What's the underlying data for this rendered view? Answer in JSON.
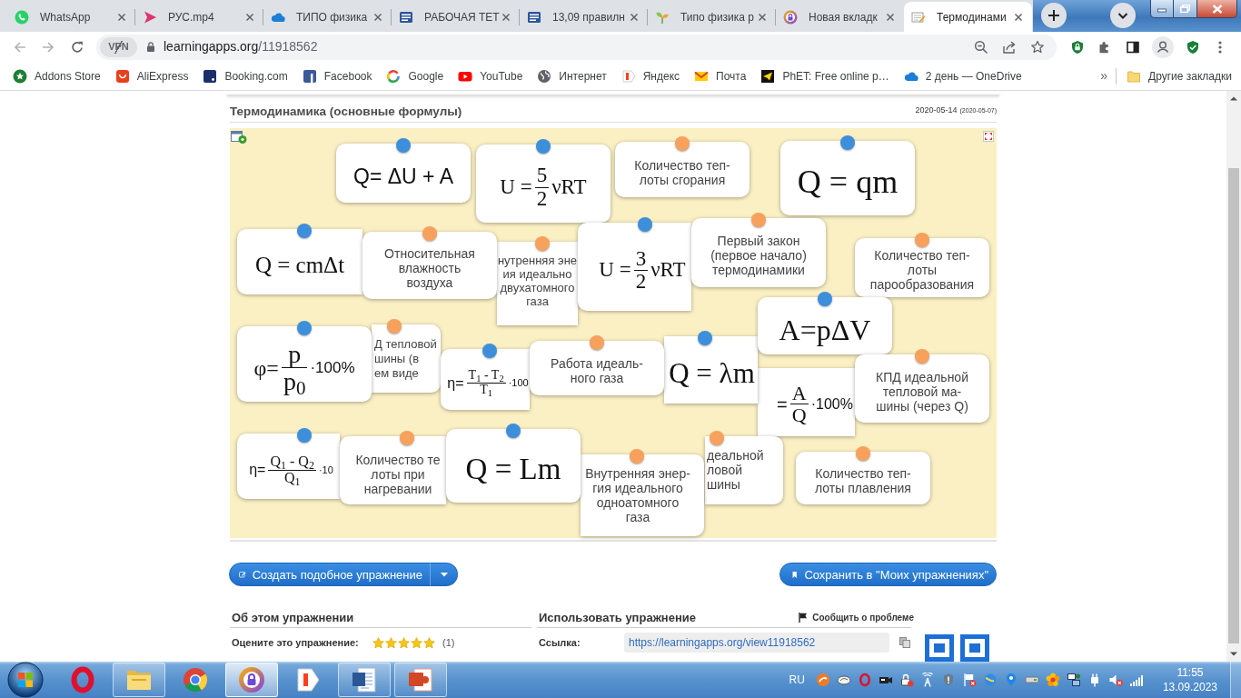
{
  "browser": {
    "tabs": [
      {
        "title": "WhatsApp",
        "selected": false
      },
      {
        "title": "РУС.mp4",
        "selected": false
      },
      {
        "title": "ТИПО физика",
        "selected": false
      },
      {
        "title": "РАБОЧАЯ ТЕТ",
        "selected": false
      },
      {
        "title": "13,09 правилн",
        "selected": false
      },
      {
        "title": "Типо физика р",
        "selected": false
      },
      {
        "title": "Новая вкладк",
        "selected": false
      },
      {
        "title": "Термодинами",
        "selected": true
      }
    ],
    "address": {
      "vpn": "VPN",
      "host": "learningapps.org",
      "path": "/11918562"
    },
    "bookmarks": [
      {
        "label": "Addons Store"
      },
      {
        "label": "AliExpress"
      },
      {
        "label": "Booking.com"
      },
      {
        "label": "Facebook"
      },
      {
        "label": "Google"
      },
      {
        "label": "YouTube"
      },
      {
        "label": "Интернет"
      },
      {
        "label": "Яндекс"
      },
      {
        "label": "Почта"
      },
      {
        "label": "PhET: Free online p…"
      },
      {
        "label": "2 день — OneDrive"
      }
    ],
    "bookmarks_overflow": "»",
    "other_bookmarks": "Другие закладки"
  },
  "exercise": {
    "title": "Термодинамика (основные формулы)",
    "updated": "2020-05-14",
    "created": "(2020-05-07)",
    "cards": [
      {
        "kind": "formula",
        "color": "#3d8fdb",
        "parts": [
          {
            "kind": "sans",
            "text": "Q= ΔU + A"
          }
        ]
      },
      {
        "kind": "formula",
        "color": "#3d8fdb",
        "parts": [
          {
            "kind": "serif",
            "text": "U ="
          },
          {
            "kind": "fraction",
            "numerator": "5",
            "denominator": "2"
          },
          {
            "kind": "serif",
            "text": "νRT"
          }
        ]
      },
      {
        "kind": "text",
        "color": "#f8a15c",
        "text": "Количество теп-\nлоты сгорания"
      },
      {
        "kind": "formula",
        "color": "#3d8fdb",
        "parts": [
          {
            "kind": "serif",
            "text": "Q = qm"
          }
        ]
      },
      {
        "kind": "formula",
        "color": "#3d8fdb",
        "parts": [
          {
            "kind": "serif",
            "text": "Q = cmΔt"
          }
        ]
      },
      {
        "kind": "text",
        "color": "#f8a15c",
        "text": "Относительная\nвлажность\nвоздуха"
      },
      {
        "kind": "text",
        "color": "#f8a15c",
        "text": "нутренняя эне\nия идеально\nдвухатомного\nгаза"
      },
      {
        "kind": "formula",
        "color": "#3d8fdb",
        "parts": [
          {
            "kind": "serif",
            "text": "U ="
          },
          {
            "kind": "fraction",
            "numerator": "3",
            "denominator": "2"
          },
          {
            "kind": "serif",
            "text": "νRT"
          }
        ]
      },
      {
        "kind": "text",
        "color": "#f8a15c",
        "text": "Первый закон\n(первое начало)\nтермодинамики"
      },
      {
        "kind": "text",
        "color": "#f8a15c",
        "text": "Количество теп-\nлоты\nпарообразования"
      },
      {
        "kind": "formula",
        "color": "#3d8fdb",
        "parts": [
          {
            "kind": "serif",
            "text": "A=pΔV"
          }
        ]
      },
      {
        "kind": "formula",
        "color": "#3d8fdb",
        "parts": [
          {
            "kind": "serif",
            "text": "φ="
          },
          {
            "kind": "fraction",
            "numerator": "p",
            "denominator": "p$_{0}$"
          },
          {
            "kind": "sans",
            "text": "·100%"
          }
        ]
      },
      {
        "kind": "text",
        "color": "#f8a15c",
        "text": "Д тепловой\nшины (в\nем виде"
      },
      {
        "kind": "formula",
        "color": "#3d8fdb",
        "parts": [
          {
            "kind": "sans",
            "text": "η="
          },
          {
            "kind": "fraction",
            "numerator": "T$_{1}$ - T$_{2}$",
            "denominator": "T$_{1}$"
          },
          {
            "kind": "sans",
            "text": "·100"
          }
        ]
      },
      {
        "kind": "text",
        "color": "#f8a15c",
        "text": "Работа идеаль-\nного газа"
      },
      {
        "kind": "formula",
        "color": "#3d8fdb",
        "parts": [
          {
            "kind": "serif",
            "text": "Q = λm"
          }
        ]
      },
      {
        "kind": "formula",
        "parts": [
          {
            "kind": "sans",
            "text": "="
          },
          {
            "kind": "fraction",
            "numerator": "A",
            "denominator": "Q"
          },
          {
            "kind": "sans",
            "text": "·100%"
          }
        ]
      },
      {
        "kind": "text",
        "color": "#f8a15c",
        "text": "КПД идеальной\nтепловой ма-\nшины (через Q)"
      },
      {
        "kind": "formula",
        "color": "#3d8fdb",
        "parts": [
          {
            "kind": "sans",
            "text": "η="
          },
          {
            "kind": "fraction",
            "numerator": "Q$_{1}$ - Q$_{2}$",
            "denominator": "Q$_{1}$"
          },
          {
            "kind": "sans",
            "text": "·10"
          }
        ]
      },
      {
        "kind": "text",
        "color": "#f8a15c",
        "text": "Количество те\nлоты при\nнагревании"
      },
      {
        "kind": "formula",
        "color": "#3d8fdb",
        "parts": [
          {
            "kind": "serif",
            "text": "Q = Lm"
          }
        ]
      },
      {
        "kind": "text",
        "color": "#f8a15c",
        "text": "деальной\nловой\nшины"
      },
      {
        "kind": "text",
        "color": "#f8a15c",
        "text": "Внутренняя энер-\nгия идеального\nодноатомного\nгаза"
      },
      {
        "kind": "text",
        "color": "#f8a15c",
        "text": "Количество теп-\nлоты плавления"
      }
    ],
    "create_button": "Создать подобное упражнение",
    "save_button": "Сохранить в \"Моих упражнениях\""
  },
  "about": {
    "heading": "Об этом упражнении",
    "rating_label": "Оцените это упражнение:",
    "stars": 5,
    "rating_count": "(1)"
  },
  "use": {
    "heading": "Использовать упражнение",
    "report_link": "Сообщить о проблеме",
    "link_label": "Ссылка:",
    "link": "https://learningapps.org/view11918562"
  },
  "taskbar": {
    "apps": [
      {
        "running": false,
        "highlighted": false
      },
      {
        "running": true,
        "highlighted": false
      },
      {
        "running": false,
        "highlighted": false
      },
      {
        "running": true,
        "highlighted": true
      },
      {
        "running": false,
        "highlighted": false
      },
      {
        "running": true,
        "highlighted": false
      },
      {
        "running": true,
        "highlighted": false
      }
    ],
    "language": "RU",
    "time": "11:55",
    "date": "13.09.2023"
  }
}
